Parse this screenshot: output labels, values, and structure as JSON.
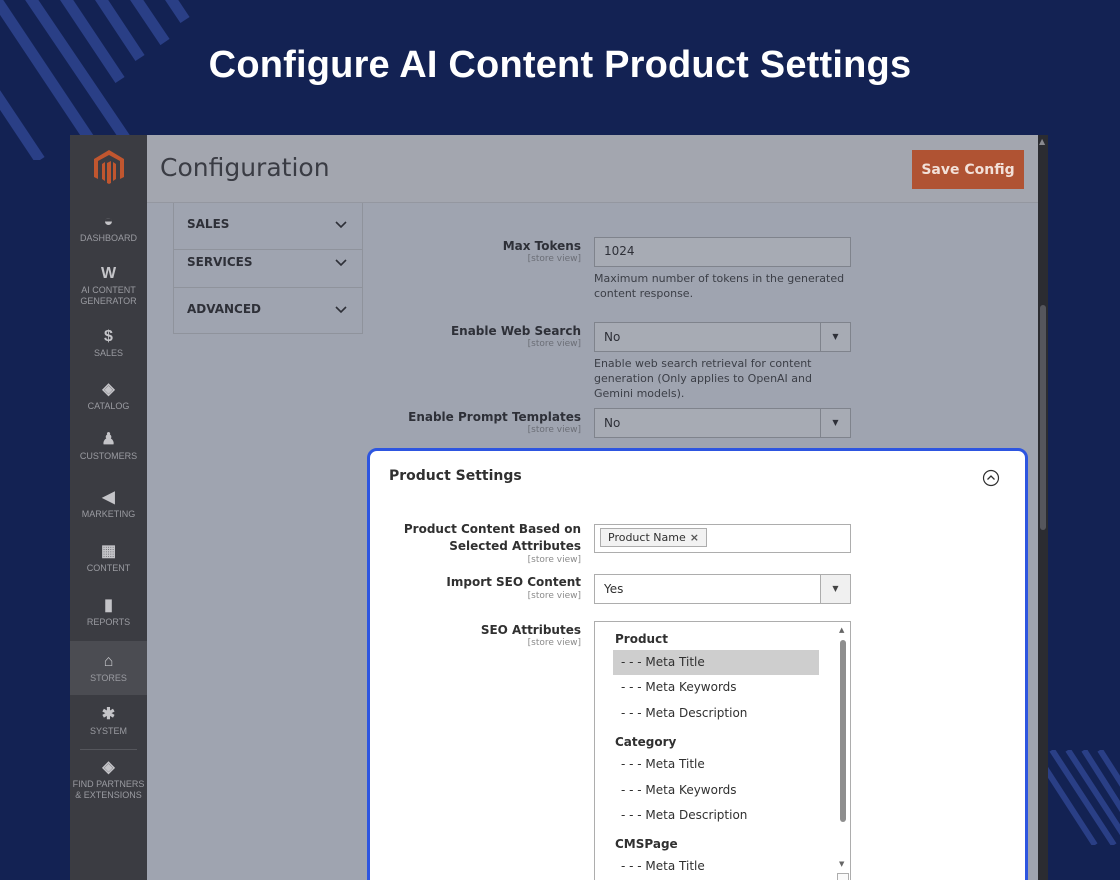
{
  "hero": {
    "title": "Configure AI Content Product Settings"
  },
  "colors": {
    "background": "#132253",
    "accent": "#2d55e0",
    "save": "#b05333",
    "sidebar": "#3b3c42"
  },
  "sidebar": {
    "items": [
      {
        "label": "DASHBOARD",
        "icon": "dashboard-icon"
      },
      {
        "label": "AI CONTENT GENERATOR",
        "icon": "ai-content-generator-icon"
      },
      {
        "label": "SALES",
        "icon": "dollar-icon"
      },
      {
        "label": "CATALOG",
        "icon": "catalog-box-icon"
      },
      {
        "label": "CUSTOMERS",
        "icon": "customer-person-icon"
      },
      {
        "label": "MARKETING",
        "icon": "megaphone-icon"
      },
      {
        "label": "CONTENT",
        "icon": "content-layout-icon"
      },
      {
        "label": "REPORTS",
        "icon": "bar-chart-icon"
      },
      {
        "label": "STORES",
        "icon": "store-icon",
        "active": true
      },
      {
        "label": "SYSTEM",
        "icon": "gear-icon"
      },
      {
        "label": "FIND PARTNERS & EXTENSIONS",
        "icon": "partners-box-icon"
      }
    ]
  },
  "header": {
    "title": "Configuration",
    "save_label": "Save Config"
  },
  "config_tabs": [
    "SALES",
    "SERVICES",
    "ADVANCED"
  ],
  "fields": {
    "max_tokens": {
      "label": "Max Tokens",
      "scope": "[store view]",
      "value": "1024",
      "note": "Maximum number of tokens in the generated content response."
    },
    "web_search": {
      "label": "Enable Web Search",
      "scope": "[store view]",
      "value": "No",
      "note": "Enable web search retrieval for content generation (Only applies to OpenAI and Gemini models)."
    },
    "prompt_templates": {
      "label": "Enable Prompt Templates",
      "scope": "[store view]",
      "value": "No"
    }
  },
  "product_settings": {
    "title": "Product Settings",
    "content_attrs": {
      "label": "Product Content Based on Selected Attributes",
      "scope": "[store view]",
      "chip": "Product Name",
      "chip_remove": "×"
    },
    "import_seo": {
      "label": "Import SEO Content",
      "scope": "[store view]",
      "value": "Yes"
    },
    "seo_attrs": {
      "label": "SEO Attributes",
      "scope": "[store view]",
      "groups": [
        {
          "name": "Product",
          "options": [
            "- - - Meta Title",
            "- - - Meta Keywords",
            "- - - Meta Description"
          ]
        },
        {
          "name": "Category",
          "options": [
            "- - - Meta Title",
            "- - - Meta Keywords",
            "- - - Meta Description"
          ]
        },
        {
          "name": "CMSPage",
          "options": [
            "- - - Meta Title"
          ]
        }
      ]
    }
  }
}
